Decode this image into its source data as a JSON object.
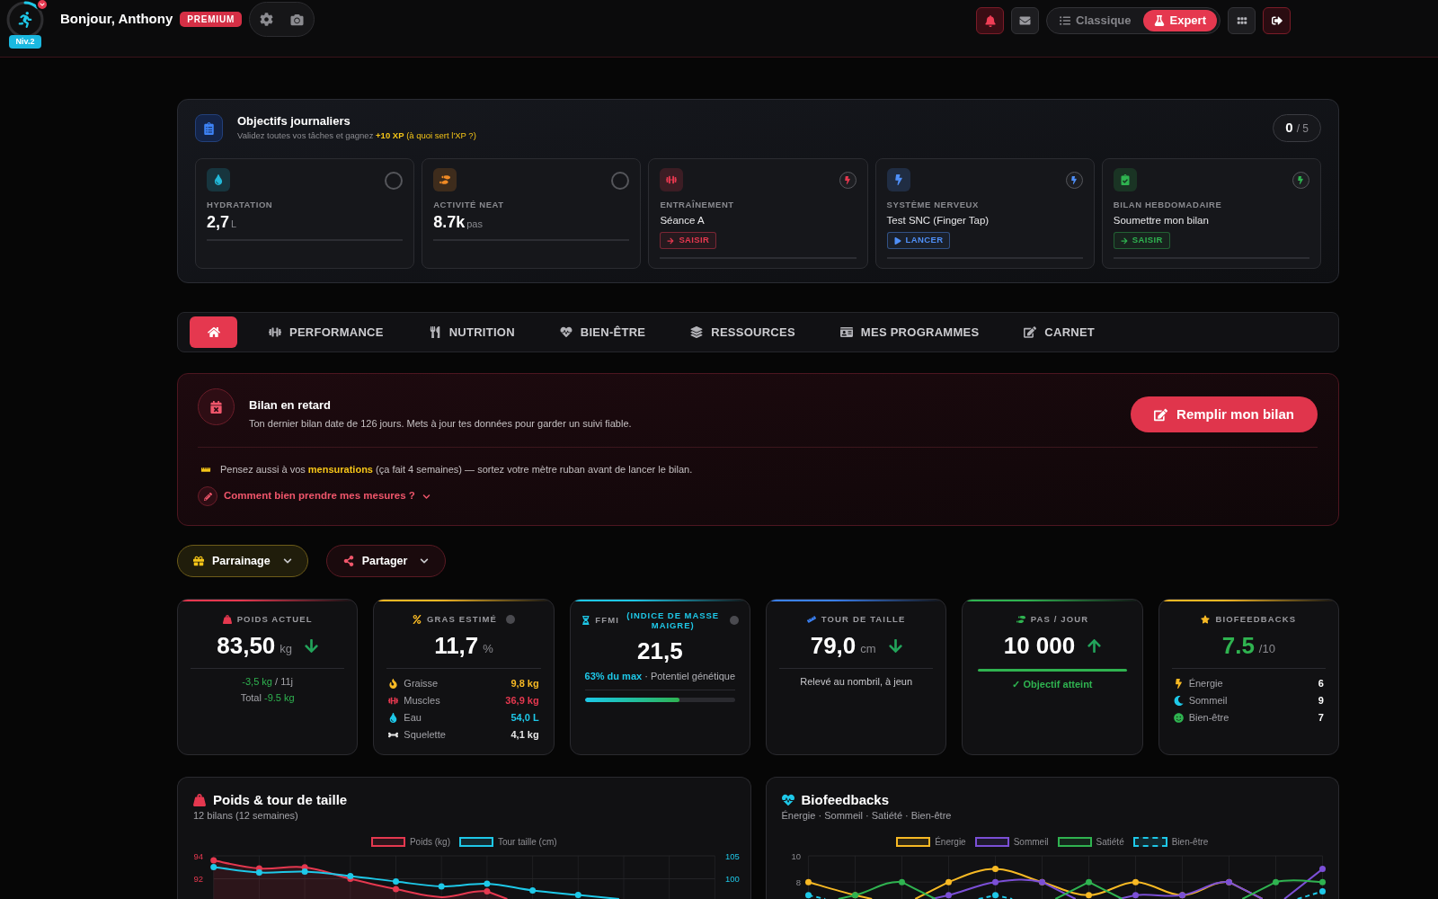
{
  "header": {
    "avatar": {
      "level": 0.12,
      "badge": "Niv.2"
    },
    "greeting": "Bonjour, Anthony",
    "plan_badge": "PREMIUM",
    "mode_toggle": [
      {
        "label": "Classique",
        "selected": false
      },
      {
        "label": "Expert",
        "selected": true
      }
    ]
  },
  "daily_objectives": {
    "title": "Objectifs journaliers",
    "subtitle": "Validez toutes vos tâches et gagnez",
    "reward": "+10 XP",
    "help_link": "(à quoi sert l'XP ?)",
    "done": "0",
    "total": "/ 5",
    "tasks": [
      {
        "kind": "metric",
        "label": "HYDRATATION",
        "value": "2,7",
        "unit": "L",
        "checked": false,
        "color": "#22b8d8"
      },
      {
        "kind": "metric",
        "label": "ACTIVITÉ NEAT",
        "value": "8.7k",
        "unit": "pas",
        "checked": false,
        "color": "#f08a24"
      },
      {
        "kind": "action",
        "label": "ENTRAÎNEMENT",
        "title": "Séance A",
        "action": "SAISIR",
        "color": "#e5384f"
      },
      {
        "kind": "action",
        "label": "SYSTÈME NERVEUX",
        "title": "Test SNC (Finger Tap)",
        "action": "LANCER",
        "color": "#4f8ff7"
      },
      {
        "kind": "action",
        "label": "BILAN HEBDOMADAIRE",
        "title": "Soumettre mon bilan",
        "action": "SAISIR",
        "color": "#2fb350"
      }
    ]
  },
  "tabs": [
    {
      "selected": true
    },
    {
      "label": "PERFORMANCE",
      "selected": false
    },
    {
      "label": "NUTRITION",
      "selected": false
    },
    {
      "label": "BIEN-ÊTRE",
      "selected": false
    },
    {
      "label": "RESSOURCES",
      "selected": false
    },
    {
      "label": "MES PROGRAMMES",
      "selected": false
    },
    {
      "label": "CARNET",
      "selected": false
    }
  ],
  "overdue_alert": {
    "title": "Bilan en retard",
    "message": "Ton dernier bilan date de 126 jours. Mets à jour tes données pour garder un suivi fiable.",
    "button": "Remplir mon bilan",
    "reminder": "Pensez aussi à vos **mensurations** (ça fait 4 semaines) — sortez votre mètre ruban avant de lancer le bilan.",
    "help_link": "Comment bien prendre mes mesures ?",
    "help_expanded": false
  },
  "action_buttons": [
    {
      "kind": "referral",
      "label": "Parrainage"
    },
    {
      "kind": "share",
      "label": "Partager"
    }
  ],
  "stats": [
    {
      "kind": "weight",
      "label": "POIDS ACTUEL",
      "color": "#e5384f",
      "info": false,
      "value": "83,50",
      "unit": "kg",
      "decreasing": true,
      "change": "-3,5 kg",
      "period": "/ 11j",
      "total_label": "Total",
      "total": "-9.5 kg"
    },
    {
      "kind": "breakdown",
      "label": "GRAS ESTIMÉ",
      "color": "#f7b924",
      "info": true,
      "value": "11,7",
      "unit": "%",
      "rows": [
        {
          "label": "Graisse",
          "value": "9,8 kg",
          "color": "#f7b924"
        },
        {
          "label": "Muscles",
          "value": "36,9 kg",
          "color": "#e5384f"
        },
        {
          "label": "Eau",
          "value": "54,0 L",
          "color": "#1ec8e8"
        },
        {
          "label": "Squelette",
          "value": "4,1 kg",
          "color": "#e5e5e5"
        }
      ]
    },
    {
      "kind": "ffmi",
      "label": "FFMI",
      "sublabel": "(INDICE DE MASSE MAIGRE)",
      "color": "#1ec8e8",
      "info": true,
      "value": "21,5",
      "note": "**63% du max** · Potentiel génétique",
      "level": 0.63
    },
    {
      "kind": "waist",
      "label": "TOUR DE TAILLE",
      "color": "#3b82f6",
      "info": false,
      "value": "79,0",
      "unit": "cm",
      "decreasing": true,
      "note": "Relevé au nombril, à jeun"
    },
    {
      "kind": "steps",
      "label": "PAS / JOUR",
      "color": "#2fb350",
      "info": false,
      "value": "10 000",
      "decreasing": false,
      "status": "✓ Objectif atteint"
    },
    {
      "kind": "biofeedback",
      "label": "BIOFEEDBACKS",
      "color": "#f7b924",
      "info": false,
      "value": "7.5",
      "unit": "/10",
      "rows": [
        {
          "label": "Énergie",
          "value": "6",
          "color": "#f7b924"
        },
        {
          "label": "Sommeil",
          "value": "9",
          "color": "#1ec8e8"
        },
        {
          "label": "Bien-être",
          "value": "7",
          "color": "#2fb350"
        }
      ]
    }
  ],
  "charts": [
    {
      "title": "Poids & tour de taille",
      "subtitle": "12 bilans (12 semaines)",
      "legend": [
        {
          "label": "Poids (kg)",
          "color": "#e5384f",
          "kind": "solid"
        },
        {
          "label": "Tour taille (cm)",
          "color": "#1ec8e8",
          "kind": "solid"
        }
      ],
      "left_axis": [
        "94",
        "92"
      ],
      "right_axis": [
        "105",
        "100"
      ]
    },
    {
      "title": "Biofeedbacks",
      "subtitle": "Énergie · Sommeil · Satiété · Bien-être",
      "legend": [
        {
          "label": "Énergie",
          "color": "#f7b924",
          "kind": "solid"
        },
        {
          "label": "Sommeil",
          "color": "#7b4fd6",
          "kind": "solid"
        },
        {
          "label": "Satiété",
          "color": "#2fb350",
          "kind": "solid"
        },
        {
          "label": "Bien-être",
          "color": "#1ec8e8",
          "kind": "dashed"
        }
      ],
      "left_axis": [
        "10",
        "8"
      ]
    }
  ]
}
